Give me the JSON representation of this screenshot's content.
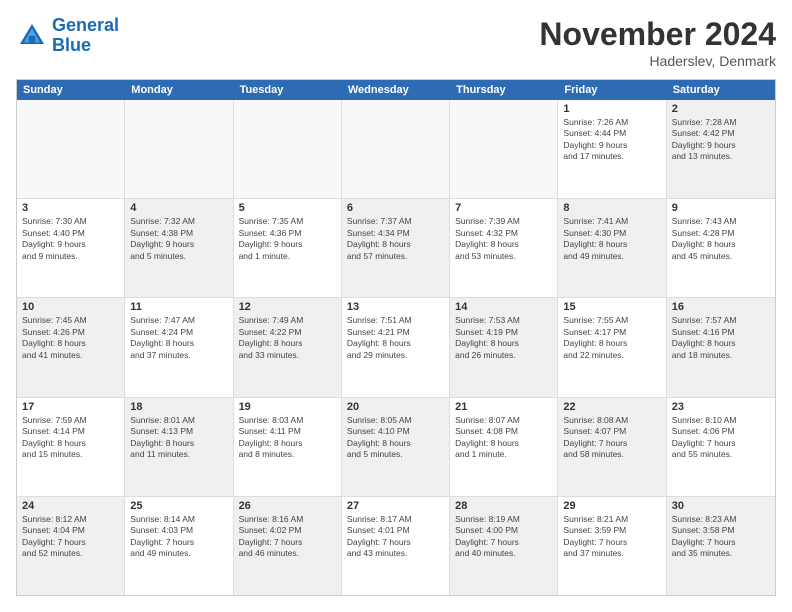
{
  "logo": {
    "line1": "General",
    "line2": "Blue"
  },
  "title": "November 2024",
  "subtitle": "Haderslev, Denmark",
  "weekdays": [
    "Sunday",
    "Monday",
    "Tuesday",
    "Wednesday",
    "Thursday",
    "Friday",
    "Saturday"
  ],
  "rows": [
    [
      {
        "day": "",
        "info": "",
        "empty": true
      },
      {
        "day": "",
        "info": "",
        "empty": true
      },
      {
        "day": "",
        "info": "",
        "empty": true
      },
      {
        "day": "",
        "info": "",
        "empty": true
      },
      {
        "day": "",
        "info": "",
        "empty": true
      },
      {
        "day": "1",
        "info": "Sunrise: 7:26 AM\nSunset: 4:44 PM\nDaylight: 9 hours\nand 17 minutes.",
        "empty": false
      },
      {
        "day": "2",
        "info": "Sunrise: 7:28 AM\nSunset: 4:42 PM\nDaylight: 9 hours\nand 13 minutes.",
        "empty": false,
        "shaded": true
      }
    ],
    [
      {
        "day": "3",
        "info": "Sunrise: 7:30 AM\nSunset: 4:40 PM\nDaylight: 9 hours\nand 9 minutes.",
        "empty": false
      },
      {
        "day": "4",
        "info": "Sunrise: 7:32 AM\nSunset: 4:38 PM\nDaylight: 9 hours\nand 5 minutes.",
        "empty": false,
        "shaded": true
      },
      {
        "day": "5",
        "info": "Sunrise: 7:35 AM\nSunset: 4:36 PM\nDaylight: 9 hours\nand 1 minute.",
        "empty": false
      },
      {
        "day": "6",
        "info": "Sunrise: 7:37 AM\nSunset: 4:34 PM\nDaylight: 8 hours\nand 57 minutes.",
        "empty": false,
        "shaded": true
      },
      {
        "day": "7",
        "info": "Sunrise: 7:39 AM\nSunset: 4:32 PM\nDaylight: 8 hours\nand 53 minutes.",
        "empty": false
      },
      {
        "day": "8",
        "info": "Sunrise: 7:41 AM\nSunset: 4:30 PM\nDaylight: 8 hours\nand 49 minutes.",
        "empty": false,
        "shaded": true
      },
      {
        "day": "9",
        "info": "Sunrise: 7:43 AM\nSunset: 4:28 PM\nDaylight: 8 hours\nand 45 minutes.",
        "empty": false
      }
    ],
    [
      {
        "day": "10",
        "info": "Sunrise: 7:45 AM\nSunset: 4:26 PM\nDaylight: 8 hours\nand 41 minutes.",
        "empty": false,
        "shaded": true
      },
      {
        "day": "11",
        "info": "Sunrise: 7:47 AM\nSunset: 4:24 PM\nDaylight: 8 hours\nand 37 minutes.",
        "empty": false
      },
      {
        "day": "12",
        "info": "Sunrise: 7:49 AM\nSunset: 4:22 PM\nDaylight: 8 hours\nand 33 minutes.",
        "empty": false,
        "shaded": true
      },
      {
        "day": "13",
        "info": "Sunrise: 7:51 AM\nSunset: 4:21 PM\nDaylight: 8 hours\nand 29 minutes.",
        "empty": false
      },
      {
        "day": "14",
        "info": "Sunrise: 7:53 AM\nSunset: 4:19 PM\nDaylight: 8 hours\nand 26 minutes.",
        "empty": false,
        "shaded": true
      },
      {
        "day": "15",
        "info": "Sunrise: 7:55 AM\nSunset: 4:17 PM\nDaylight: 8 hours\nand 22 minutes.",
        "empty": false
      },
      {
        "day": "16",
        "info": "Sunrise: 7:57 AM\nSunset: 4:16 PM\nDaylight: 8 hours\nand 18 minutes.",
        "empty": false,
        "shaded": true
      }
    ],
    [
      {
        "day": "17",
        "info": "Sunrise: 7:59 AM\nSunset: 4:14 PM\nDaylight: 8 hours\nand 15 minutes.",
        "empty": false
      },
      {
        "day": "18",
        "info": "Sunrise: 8:01 AM\nSunset: 4:13 PM\nDaylight: 8 hours\nand 11 minutes.",
        "empty": false,
        "shaded": true
      },
      {
        "day": "19",
        "info": "Sunrise: 8:03 AM\nSunset: 4:11 PM\nDaylight: 8 hours\nand 8 minutes.",
        "empty": false
      },
      {
        "day": "20",
        "info": "Sunrise: 8:05 AM\nSunset: 4:10 PM\nDaylight: 8 hours\nand 5 minutes.",
        "empty": false,
        "shaded": true
      },
      {
        "day": "21",
        "info": "Sunrise: 8:07 AM\nSunset: 4:08 PM\nDaylight: 8 hours\nand 1 minute.",
        "empty": false
      },
      {
        "day": "22",
        "info": "Sunrise: 8:08 AM\nSunset: 4:07 PM\nDaylight: 7 hours\nand 58 minutes.",
        "empty": false,
        "shaded": true
      },
      {
        "day": "23",
        "info": "Sunrise: 8:10 AM\nSunset: 4:06 PM\nDaylight: 7 hours\nand 55 minutes.",
        "empty": false
      }
    ],
    [
      {
        "day": "24",
        "info": "Sunrise: 8:12 AM\nSunset: 4:04 PM\nDaylight: 7 hours\nand 52 minutes.",
        "empty": false,
        "shaded": true
      },
      {
        "day": "25",
        "info": "Sunrise: 8:14 AM\nSunset: 4:03 PM\nDaylight: 7 hours\nand 49 minutes.",
        "empty": false
      },
      {
        "day": "26",
        "info": "Sunrise: 8:16 AM\nSunset: 4:02 PM\nDaylight: 7 hours\nand 46 minutes.",
        "empty": false,
        "shaded": true
      },
      {
        "day": "27",
        "info": "Sunrise: 8:17 AM\nSunset: 4:01 PM\nDaylight: 7 hours\nand 43 minutes.",
        "empty": false
      },
      {
        "day": "28",
        "info": "Sunrise: 8:19 AM\nSunset: 4:00 PM\nDaylight: 7 hours\nand 40 minutes.",
        "empty": false,
        "shaded": true
      },
      {
        "day": "29",
        "info": "Sunrise: 8:21 AM\nSunset: 3:59 PM\nDaylight: 7 hours\nand 37 minutes.",
        "empty": false
      },
      {
        "day": "30",
        "info": "Sunrise: 8:23 AM\nSunset: 3:58 PM\nDaylight: 7 hours\nand 35 minutes.",
        "empty": false,
        "shaded": true
      }
    ]
  ]
}
